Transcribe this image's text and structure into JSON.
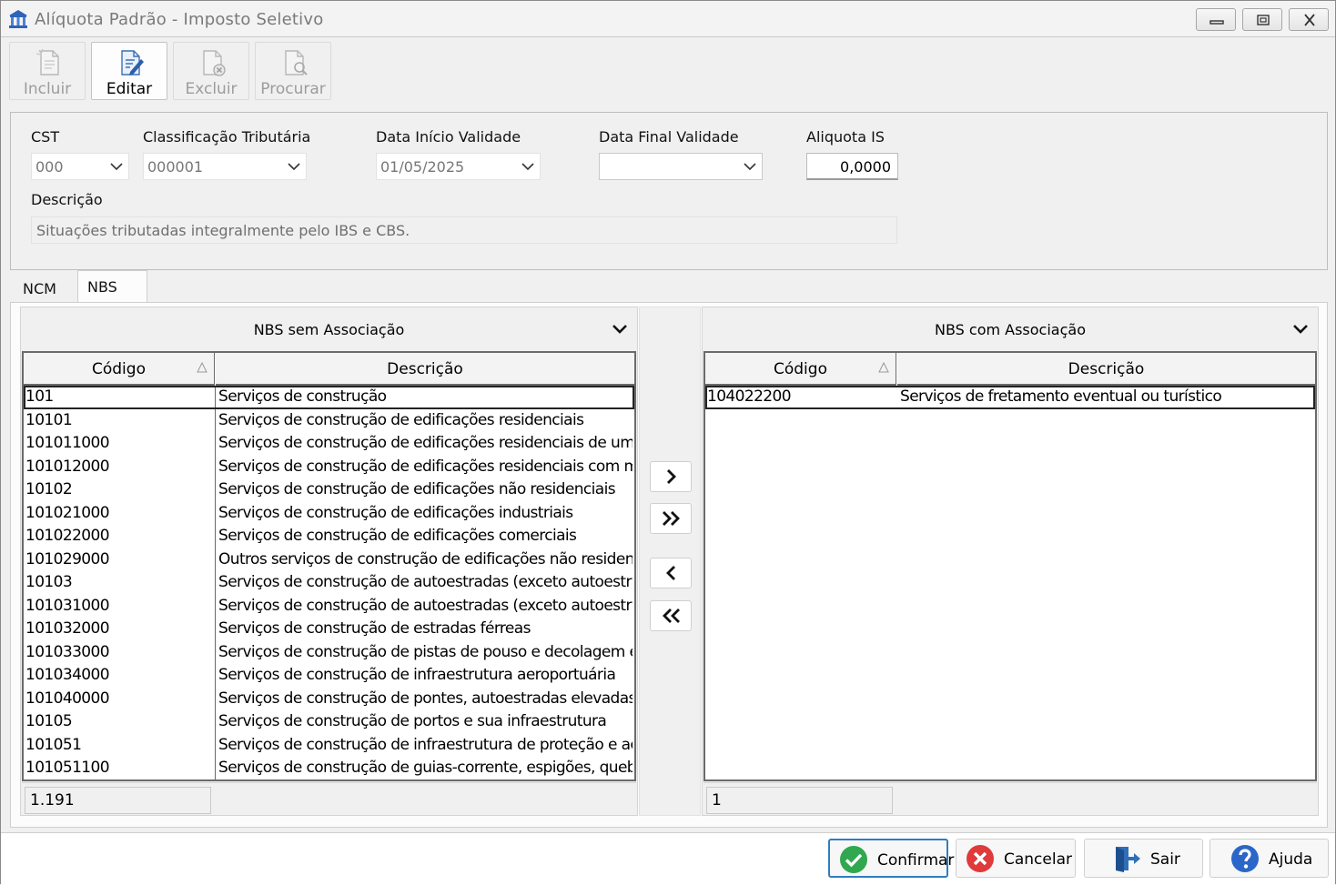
{
  "window": {
    "title": "Alíquota Padrão - Imposto Seletivo",
    "app_icon": "bank-building-icon"
  },
  "toolbar": {
    "incluir_label": "Incluir",
    "editar_label": "Editar",
    "excluir_label": "Excluir",
    "procurar_label": "Procurar"
  },
  "form": {
    "cst_label": "CST",
    "cst_value": "000",
    "classificacao_label": "Classificação Tributária",
    "classificacao_value": "000001",
    "data_inicio_label": "Data Início Validade",
    "data_inicio_value": "01/05/2025",
    "data_final_label": "Data Final Validade",
    "data_final_value": "",
    "aliquota_label": "Aliquota IS",
    "aliquota_value": "0,0000",
    "descricao_label": "Descrição",
    "descricao_value": "Situações tributadas integralmente pelo IBS e CBS."
  },
  "tabs": [
    {
      "label": "NCM",
      "selected": false
    },
    {
      "label": "NBS",
      "selected": true
    }
  ],
  "left_grid": {
    "title": "NBS sem Associação",
    "col_codigo": "Código",
    "col_descricao": "Descrição",
    "rows": [
      {
        "codigo": "101",
        "descricao": "Serviços de construção"
      },
      {
        "codigo": "10101",
        "descricao": "Serviços de construção de edificações residenciais"
      },
      {
        "codigo": "101011000",
        "descricao": "Serviços de construção de edificações residenciais de um e dois"
      },
      {
        "codigo": "101012000",
        "descricao": "Serviços de construção de edificações residenciais com mais de"
      },
      {
        "codigo": "10102",
        "descricao": "Serviços de construção de edificações não residenciais"
      },
      {
        "codigo": "101021000",
        "descricao": "Serviços de construção de edificações industriais"
      },
      {
        "codigo": "101022000",
        "descricao": "Serviços de construção de edificações comerciais"
      },
      {
        "codigo": "101029000",
        "descricao": "Outros serviços de construção de edificações não residenciais"
      },
      {
        "codigo": "10103",
        "descricao": "Serviços de construção de autoestradas (exceto autoestradas el"
      },
      {
        "codigo": "101031000",
        "descricao": "Serviços de construção de autoestradas (exceto autoestradas el"
      },
      {
        "codigo": "101032000",
        "descricao": "Serviços de construção de estradas férreas"
      },
      {
        "codigo": "101033000",
        "descricao": "Serviços de construção de pistas de pouso e decolagem em aer"
      },
      {
        "codigo": "101034000",
        "descricao": "Serviços de construção de infraestrutura aeroportuária"
      },
      {
        "codigo": "101040000",
        "descricao": "Serviços de construção de pontes, autoestradas elevadas e túni"
      },
      {
        "codigo": "10105",
        "descricao": "Serviços de construção de portos e sua infraestrutura"
      },
      {
        "codigo": "101051",
        "descricao": "Serviços de construção de infraestrutura de proteção e acesso a"
      },
      {
        "codigo": "101051100",
        "descricao": "Serviços de construção de guias-corrente, espigões, quebra-mar"
      }
    ],
    "count": "1.191"
  },
  "right_grid": {
    "title": "NBS com Associação",
    "col_codigo": "Código",
    "col_descricao": "Descrição",
    "rows": [
      {
        "codigo": "104022200",
        "descricao": "Serviços de fretamento eventual ou turístico"
      }
    ],
    "count": "1"
  },
  "bottom": {
    "confirmar_label": "Confirmar",
    "cancelar_label": "Cancelar",
    "sair_label": "Sair",
    "ajuda_label": "Ajuda"
  },
  "colors": {
    "confirm_green": "#2fa84f",
    "cancel_red": "#e03a3a",
    "help_blue": "#2b66c9",
    "exit_blue": "#2f6fb8",
    "primary_border": "#2f7dc1"
  }
}
